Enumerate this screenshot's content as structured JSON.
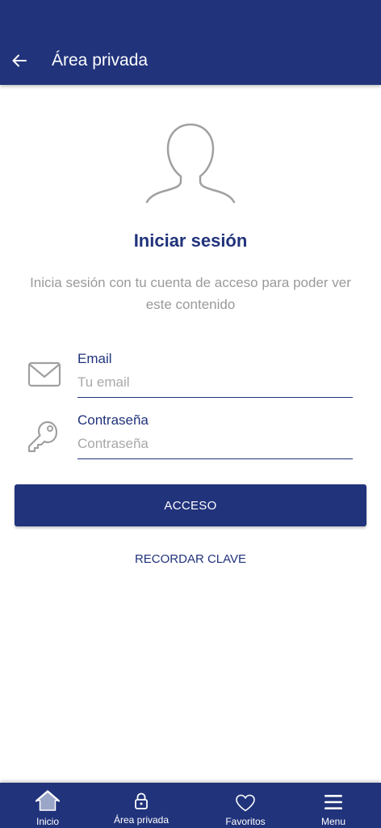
{
  "header": {
    "title": "Área privada"
  },
  "login": {
    "title": "Iniciar sesión",
    "subtitle": "Inicia sesión con tu cuenta de acceso para poder ver este contenido"
  },
  "form": {
    "email": {
      "label": "Email",
      "placeholder": "Tu email",
      "value": ""
    },
    "password": {
      "label": "Contraseña",
      "placeholder": "Contraseña",
      "value": ""
    },
    "submit_label": "ACCESO",
    "recover_label": "RECORDAR CLAVE"
  },
  "bottom_nav": {
    "items": [
      {
        "label": "Inicio",
        "icon": "home-icon"
      },
      {
        "label": "Área privada",
        "icon": "lock-icon"
      },
      {
        "label": "Favoritos",
        "icon": "heart-icon"
      },
      {
        "label": "Menu",
        "icon": "hamburger-menu-icon"
      }
    ]
  },
  "colors": {
    "primary": "#21337b",
    "muted_text": "#9a9a9a",
    "icon_gray": "#a0a0a0"
  }
}
